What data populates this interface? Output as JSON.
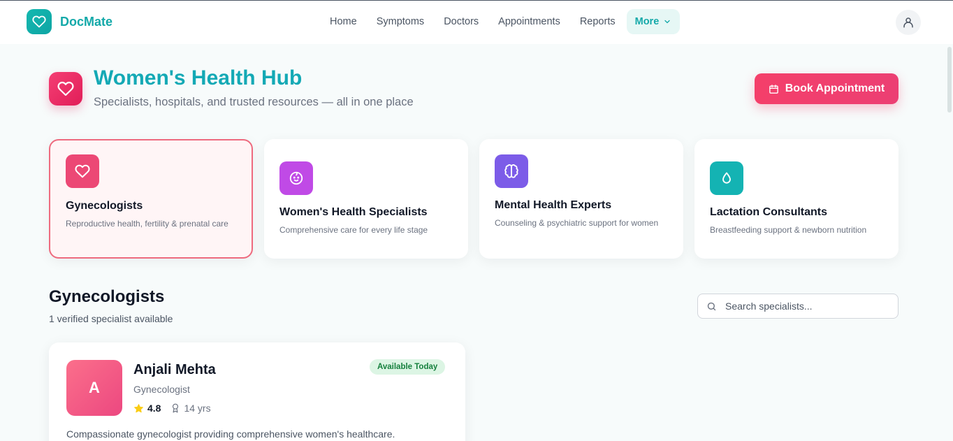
{
  "brand": {
    "name": "DocMate"
  },
  "nav": {
    "links": [
      "Home",
      "Symptoms",
      "Doctors",
      "Appointments",
      "Reports"
    ],
    "more_label": "More"
  },
  "hero": {
    "title": "Women's Health Hub",
    "subtitle": "Specialists, hospitals, and trusted resources — all in one place",
    "book_label": "Book Appointment"
  },
  "categories": [
    {
      "title": "Gynecologists",
      "desc": "Reproductive health, fertility & prenatal care",
      "icon": "heart-icon",
      "color": "#ec4875",
      "active": true
    },
    {
      "title": "Women's Health Specialists",
      "desc": "Comprehensive care for every life stage",
      "icon": "baby-icon",
      "color": "#c04ae6",
      "active": false
    },
    {
      "title": "Mental Health Experts",
      "desc": "Counseling & psychiatric support for women",
      "icon": "brain-icon",
      "color": "#7c5ce8",
      "active": false
    },
    {
      "title": "Lactation Consultants",
      "desc": "Breastfeeding support & newborn nutrition",
      "icon": "droplet-icon",
      "color": "#14b3b3",
      "active": false
    }
  ],
  "section": {
    "title": "Gynecologists",
    "count_text": "1 verified specialist available",
    "search_placeholder": "Search specialists..."
  },
  "doctor": {
    "initial": "A",
    "name": "Anjali Mehta",
    "specialty": "Gynecologist",
    "rating": "4.8",
    "experience": "14 yrs",
    "badge": "Available Today",
    "bio": "Compassionate gynecologist providing comprehensive women's healthcare."
  },
  "colors": {
    "brand": "#14a9a9",
    "accent": "#f43f6a"
  }
}
